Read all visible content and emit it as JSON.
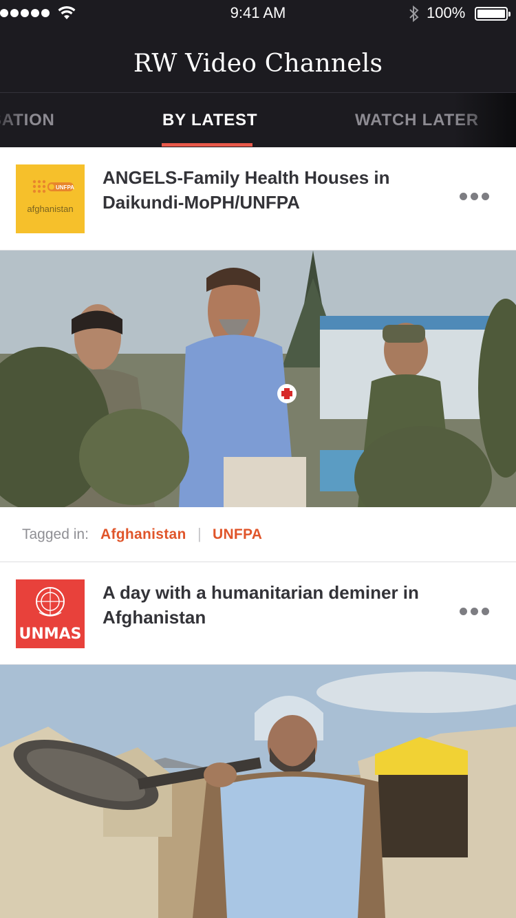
{
  "status_bar": {
    "time": "9:41 AM",
    "battery": "100%"
  },
  "header": {
    "title": "RW Video Channels"
  },
  "tabs": [
    {
      "label": "SATION",
      "active": false
    },
    {
      "label": "BY LATEST",
      "active": true
    },
    {
      "label": "WATCH LATER",
      "active": false
    }
  ],
  "videos": [
    {
      "title": "ANGELS-Family Health Houses in Daikundi-MoPH/UNFPA",
      "channel_logo": {
        "badge": "UNFPA",
        "caption": "afghanistan",
        "color": "#f6c02b"
      },
      "tagged_label": "Tagged in:",
      "tags": [
        "Afghanistan",
        "UNFPA"
      ]
    },
    {
      "title": "A day with a humanitarian deminer in Afghanistan",
      "channel_logo": {
        "badge": "UNMAS",
        "color": "#e8413b"
      }
    }
  ],
  "colors": {
    "header_bg": "#1c1b20",
    "accent": "#e8594a",
    "tag_link": "#e0552a"
  }
}
